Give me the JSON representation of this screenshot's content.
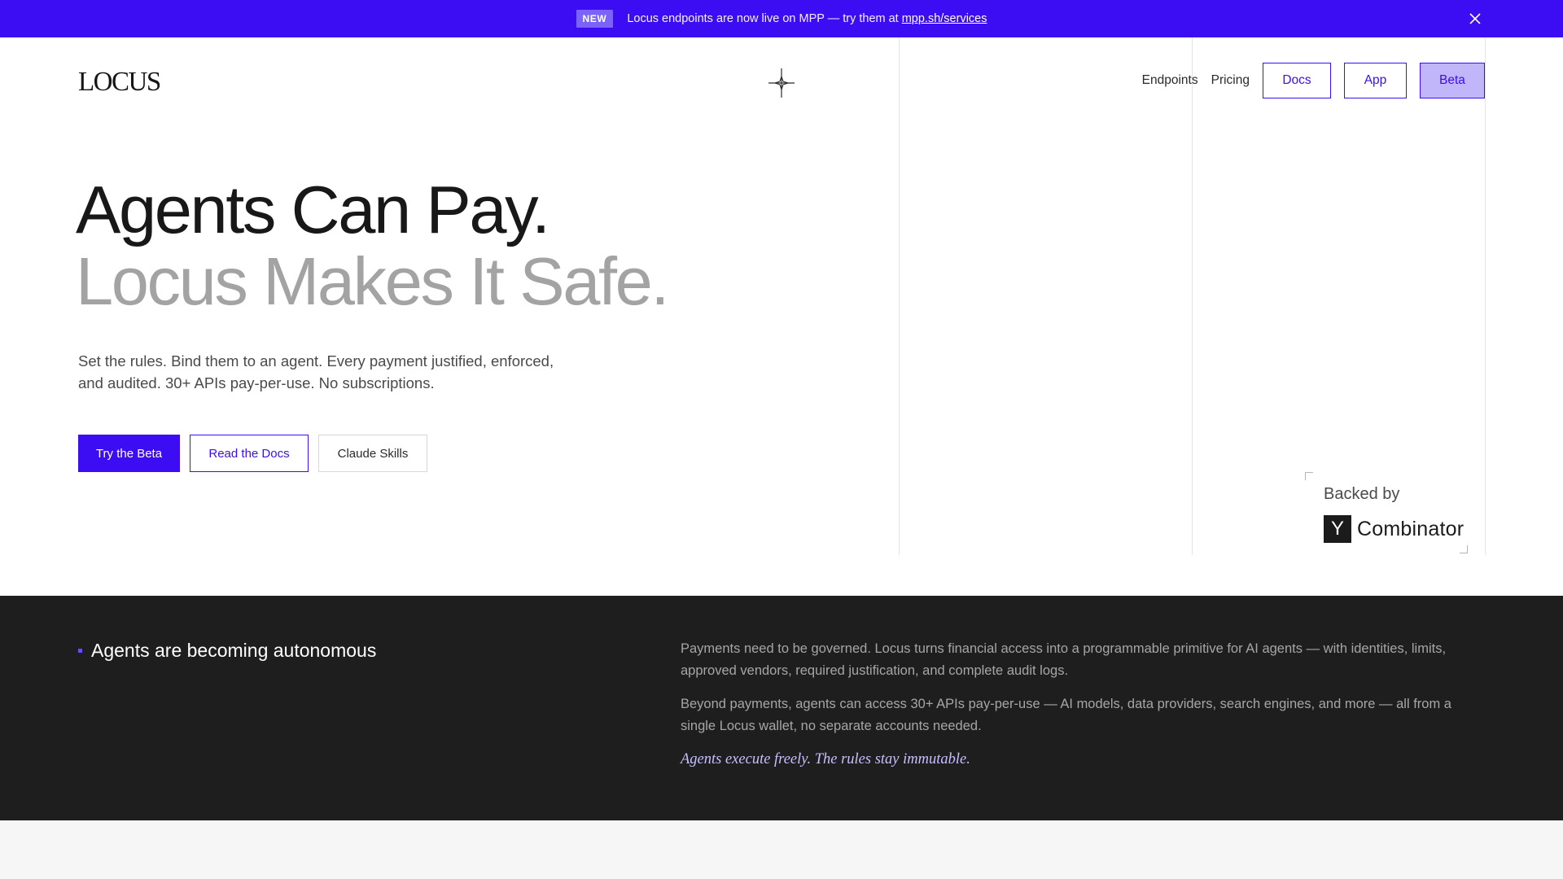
{
  "announcement": {
    "badge": "NEW",
    "message": "Locus endpoints are now live on MPP — try them at",
    "link": "mpp.sh/services"
  },
  "header": {
    "logo": "LOCUS",
    "nav": {
      "endpoints": "Endpoints",
      "pricing": "Pricing",
      "docs": "Docs",
      "app": "App",
      "beta": "Beta"
    }
  },
  "hero": {
    "headline_line1": "Agents Can Pay.",
    "headline_line2": "Locus Makes It Safe.",
    "subtext": "Set the rules. Bind them to an agent. Every payment justified, enforced, and audited. 30+ APIs pay-per-use. No subscriptions.",
    "cta_primary": "Try the Beta",
    "cta_secondary": "Read the Docs",
    "cta_tertiary": "Claude Skills",
    "backed_by": "Backed by",
    "yc_letter": "Y",
    "yc_name": "Combinator"
  },
  "about": {
    "heading": "Agents are becoming autonomous",
    "paragraph1": "Payments need to be governed. Locus turns financial access into a programmable primitive for AI agents — with identities, limits, approved vendors, required justification, and complete audit logs.",
    "paragraph2": "Beyond payments, agents can access 30+ APIs pay-per-use — AI models, data providers, search engines, and more — all from a single Locus wallet, no separate accounts needed.",
    "tagline": "Agents execute freely. The rules stay immutable."
  },
  "icons": {
    "close": "close-icon",
    "sparkle": "sparkle-icon"
  },
  "colors": {
    "brand": "#3c0cf3",
    "beta_fill": "#c2b6fb",
    "dark_bg": "#1e1e1e",
    "headline_secondary": "#a3a3a3"
  }
}
